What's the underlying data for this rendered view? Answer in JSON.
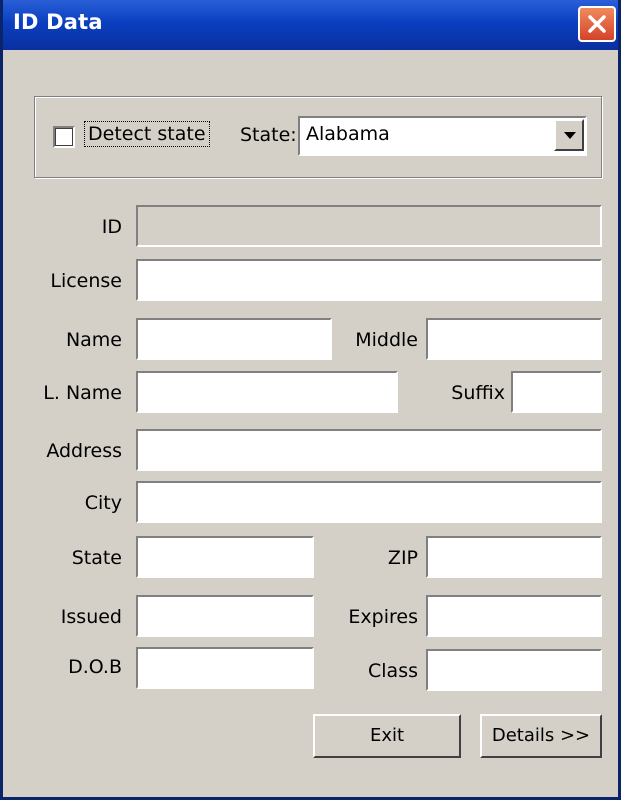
{
  "window": {
    "title": "ID Data"
  },
  "detect": {
    "checkbox_label": "Detect state",
    "checked": false,
    "state_label": "State:",
    "state_value": "Alabama"
  },
  "fields": {
    "id_label": "ID",
    "license_label": "License",
    "name_label": "Name",
    "middle_label": "Middle",
    "lname_label": "L. Name",
    "suffix_label": "Suffix",
    "address_label": "Address",
    "city_label": "City",
    "state_label": "State",
    "zip_label": "ZIP",
    "issued_label": "Issued",
    "expires_label": "Expires",
    "dob_label": "D.O.B",
    "class_label": "Class"
  },
  "buttons": {
    "exit_label": "Exit",
    "details_label": "Details >>"
  }
}
